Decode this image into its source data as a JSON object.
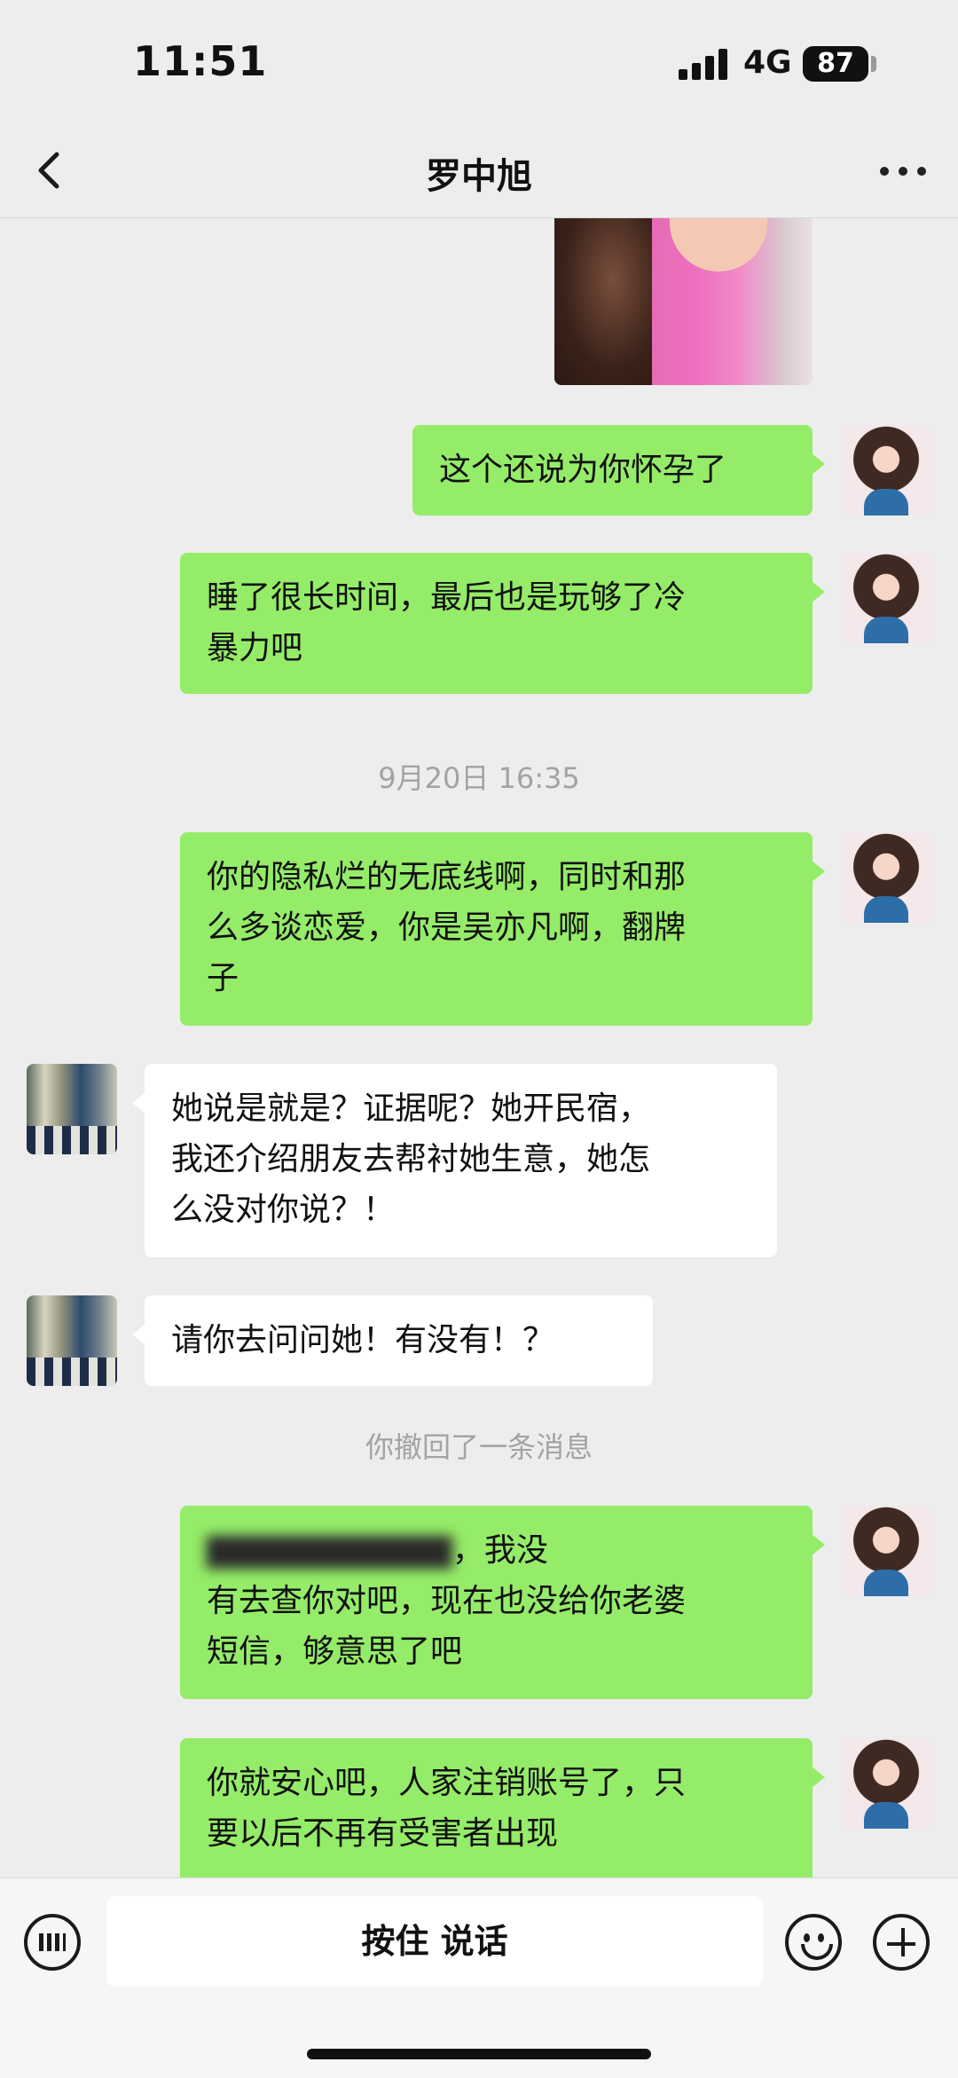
{
  "status_bar": {
    "time": "11:51",
    "network": "4G",
    "battery": "87"
  },
  "nav": {
    "title": "罗中旭"
  },
  "messages": {
    "m1": "这个还说为你怀孕了",
    "m2_l1": "睡了很长时间，最后也是玩够了冷",
    "m2_l2": "暴力吧",
    "timestamp": "9月20日 16:35",
    "m3_l1": "你的隐私烂的无底线啊，同时和那",
    "m3_l2": "么多谈恋爱，你是吴亦凡啊，翻牌",
    "m3_l3": "子",
    "m4_l1": "她说是就是？证据呢？她开民宿，",
    "m4_l2": "我还介绍朋友去帮衬她生意，她怎",
    "m4_l3": "么没对你说？！",
    "m5": "请你去问问她！有没有！？",
    "recall_notice": "你撤回了一条消息",
    "m6_l1_visible": "，我没",
    "m6_l2": "有去查你对吧，现在也没给你老婆",
    "m6_l3": "短信，够意思了吧",
    "m7_l1": "你就安心吧，人家注销账号了，只",
    "m7_l2": "要以后不再有受害者出现"
  },
  "input_bar": {
    "hold_to_talk": "按住 说话"
  },
  "icons": {
    "back": "chevron-left-icon",
    "more": "more-dots-icon",
    "keyboard": "keyboard-icon",
    "emoji": "emoji-icon",
    "plus": "plus-icon"
  },
  "colors": {
    "sent_bubble": "#95ec69",
    "received_bubble": "#ffffff",
    "background": "#ededed"
  }
}
